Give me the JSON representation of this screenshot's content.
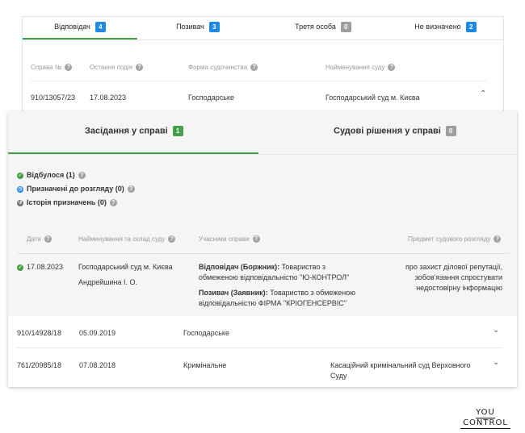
{
  "tabs": [
    {
      "label": "Відповідач",
      "count": "4",
      "color": "#1e88e5"
    },
    {
      "label": "Позивач",
      "count": "3",
      "color": "#1e88e5"
    },
    {
      "label": "Третя особа",
      "count": "0",
      "color": "#9e9e9e"
    },
    {
      "label": "Не визначено",
      "count": "2",
      "color": "#1e88e5"
    }
  ],
  "headers": {
    "case_no": "Справа №",
    "last_event": "Остання подія",
    "form": "Форма судочинства",
    "court": "Найменування суду"
  },
  "case1": {
    "case_no": "910/13057/23",
    "date": "17.08.2023",
    "form": "Господарське",
    "court": "Господарський суд м. Києва"
  },
  "panel": {
    "tab_hearings": {
      "label": "Засідання у справі",
      "count": "1"
    },
    "tab_decisions": {
      "label": "Судові рішення у справі",
      "count": "0"
    },
    "statuses": [
      {
        "label": "Відбулося (1)",
        "icon": "check-circle-icon"
      },
      {
        "label": "Призначені до розгляду (0)",
        "icon": "clock-icon"
      },
      {
        "label": "Історія призначень (0)",
        "icon": "history-icon"
      }
    ],
    "columns": {
      "date": "Дата",
      "court": "Найменування та склад суду",
      "participants": "Учасники справи",
      "subject": "Предмет судового розгляду"
    },
    "hearing": {
      "date": "17.08.2023",
      "court": "Господарський суд м. Києва",
      "judge": "Андрейшина І. О.",
      "p1_role": "Відповідач (Боржник):",
      "p1_line1": "Товариство з",
      "p1_line2": "обмеженою відповідальністю \"Ю-КОНТРОЛ\"",
      "p2_role": "Позивач (Заявник):",
      "p2_line1": "Товариство з обмеженою",
      "p2_line2": "відповідальністю ФІРМА \"КРІОГЕНСЕРВІС\"",
      "subject_line1": "про захист ділової репутації,",
      "subject_line2": "зобов'язання спростувати",
      "subject_line3": "недостовірну інформацію"
    }
  },
  "case2": {
    "case_no": "910/14928/18",
    "date": "05.09.2019",
    "form": "Господарське"
  },
  "case3": {
    "case_no": "761/20985/18",
    "date": "07.08.2018",
    "form": "Кримінальне",
    "court_line1": "Касаційний кримінальний суд Верховного",
    "court_line2": "Суду"
  },
  "logo": {
    "line1": "YOU",
    "line2": "CONTROL"
  }
}
